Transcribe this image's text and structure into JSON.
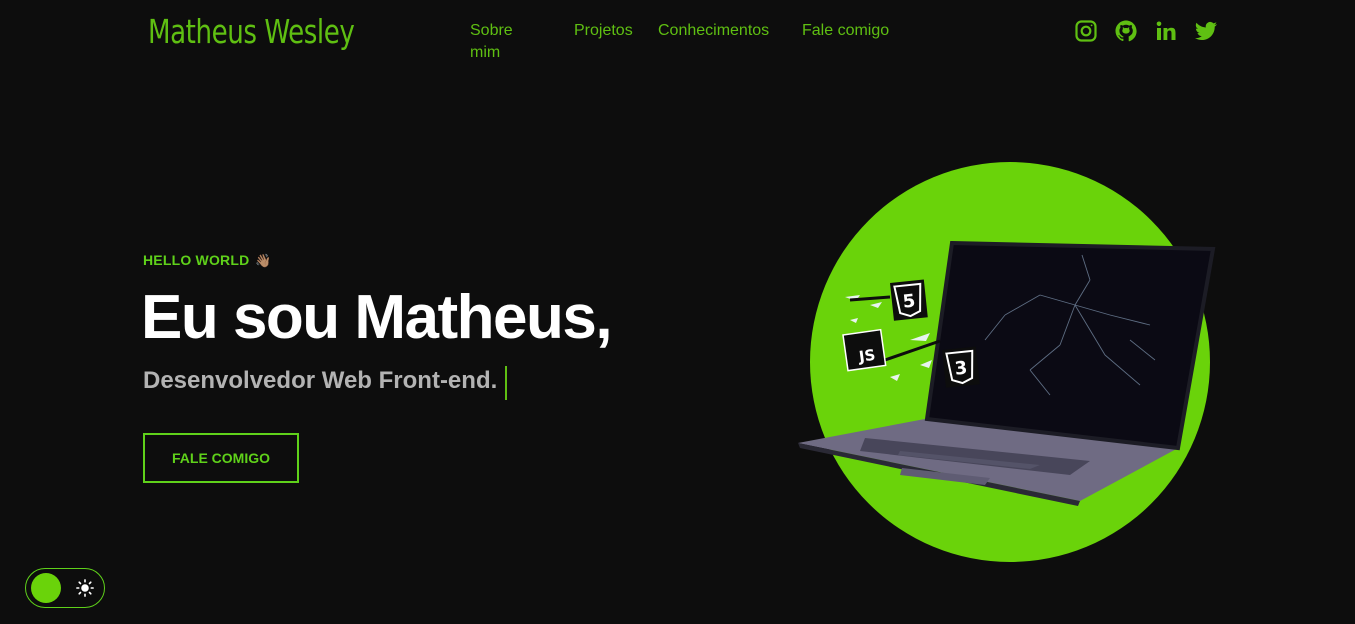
{
  "header": {
    "logo": "Matheus Wesley",
    "nav": [
      "Sobre mim",
      "Projetos",
      "Conhecimentos",
      "Fale comigo"
    ],
    "socials": [
      "instagram-icon",
      "github-icon",
      "linkedin-icon",
      "twitter-icon"
    ]
  },
  "hero": {
    "greeting": "HELLO WORLD",
    "greeting_emoji": "👋🏽",
    "title": "Eu sou Matheus,",
    "subtitle": "Desenvolvedor Web Front-end.",
    "cta_label": "FALE COMIGO",
    "badges": [
      "5",
      "JS",
      "3"
    ]
  },
  "theme_toggle": {
    "icon": "sun-icon",
    "state": "dark"
  },
  "colors": {
    "accent": "#6ad30a",
    "accent_text": "#5fbf12",
    "background": "#0d0d0d",
    "title": "#ffffff",
    "subtitle": "#b3b3b3"
  }
}
